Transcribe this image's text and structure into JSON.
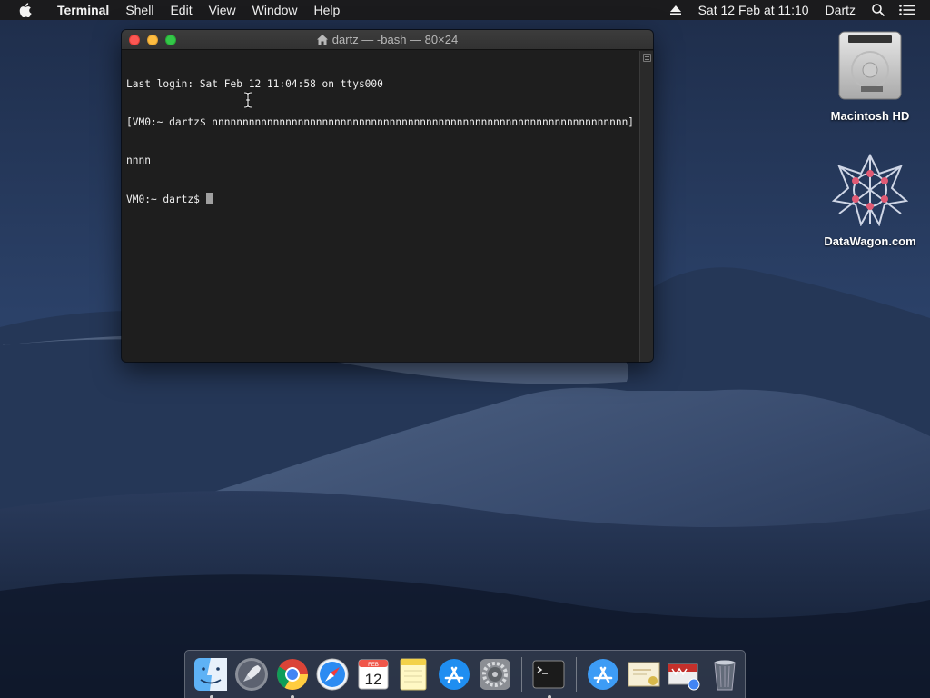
{
  "menubar": {
    "app_name": "Terminal",
    "items": [
      "Shell",
      "Edit",
      "View",
      "Window",
      "Help"
    ],
    "datetime": "Sat 12 Feb at  11:10",
    "user": "Dartz"
  },
  "terminal": {
    "title": "dartz — -bash — 80×24",
    "lines": [
      "Last login: Sat Feb 12 11:04:58 on ttys000",
      "[VM0:~ dartz$ nnnnnnnnnnnnnnnnnnnnnnnnnnnnnnnnnnnnnnnnnnnnnnnnnnnnnnnnnnnnnnnnnnnn]",
      "nnnn",
      "VM0:~ dartz$ "
    ]
  },
  "desktop_icons": [
    {
      "label": "Macintosh HD",
      "icon": "hard-drive-icon"
    },
    {
      "label": "DataWagon.com",
      "icon": "star-network-icon"
    }
  ],
  "dock": {
    "apps": [
      {
        "name": "finder",
        "icon": "finder-icon",
        "running": true
      },
      {
        "name": "launchpad",
        "icon": "rocket-icon",
        "running": false
      },
      {
        "name": "chrome",
        "icon": "chrome-icon",
        "running": true
      },
      {
        "name": "safari",
        "icon": "compass-icon",
        "running": false
      },
      {
        "name": "calendar",
        "icon": "calendar-icon",
        "running": false
      },
      {
        "name": "notes",
        "icon": "notes-icon",
        "running": false
      },
      {
        "name": "app-store",
        "icon": "app-store-icon",
        "running": false
      },
      {
        "name": "system-preferences",
        "icon": "gear-icon",
        "running": false
      },
      {
        "name": "terminal",
        "icon": "terminal-icon",
        "running": true
      }
    ],
    "others": [
      {
        "name": "applications",
        "icon": "app-store-folder-icon"
      },
      {
        "name": "certificate",
        "icon": "certificate-icon"
      },
      {
        "name": "downloads",
        "icon": "downloads-icon"
      },
      {
        "name": "trash",
        "icon": "trash-icon"
      }
    ],
    "calendar_month": "FEB",
    "calendar_day": "12"
  },
  "colors": {
    "menubar_bg": "#1b1b1d",
    "terminal_bg": "#1e1e1e",
    "close": "#fc5753",
    "minimize": "#fdbc40",
    "maximize": "#33c748"
  }
}
